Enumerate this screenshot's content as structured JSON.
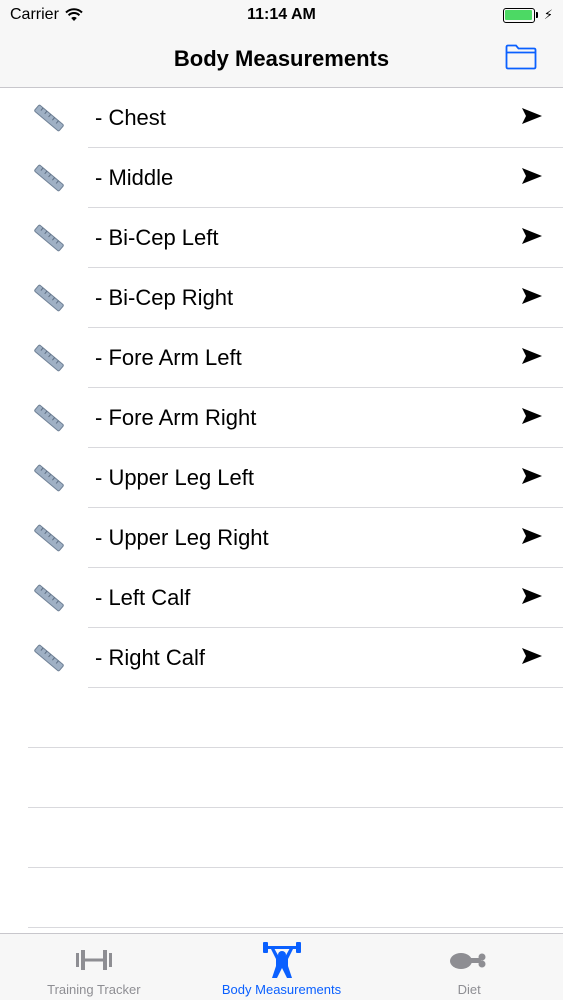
{
  "status_bar": {
    "carrier": "Carrier",
    "time": "11:14 AM"
  },
  "nav": {
    "title": "Body Measurements"
  },
  "measurements": [
    {
      "label": "- Chest"
    },
    {
      "label": "- Middle"
    },
    {
      "label": "- Bi-Cep Left"
    },
    {
      "label": "- Bi-Cep Right"
    },
    {
      "label": "- Fore Arm Left"
    },
    {
      "label": "- Fore Arm Right"
    },
    {
      "label": "- Upper Leg Left"
    },
    {
      "label": "- Upper Leg Right"
    },
    {
      "label": "- Left Calf"
    },
    {
      "label": "- Right Calf"
    }
  ],
  "tabs": [
    {
      "label": "Training Tracker",
      "icon": "barbell-icon",
      "active": false
    },
    {
      "label": "Body Measurements",
      "icon": "weightlifter-icon",
      "active": true
    },
    {
      "label": "Diet",
      "icon": "drumstick-icon",
      "active": false
    }
  ],
  "colors": {
    "accent": "#0a60ff",
    "battery": "#4cd964",
    "inactive_tab": "#8e8e93"
  }
}
